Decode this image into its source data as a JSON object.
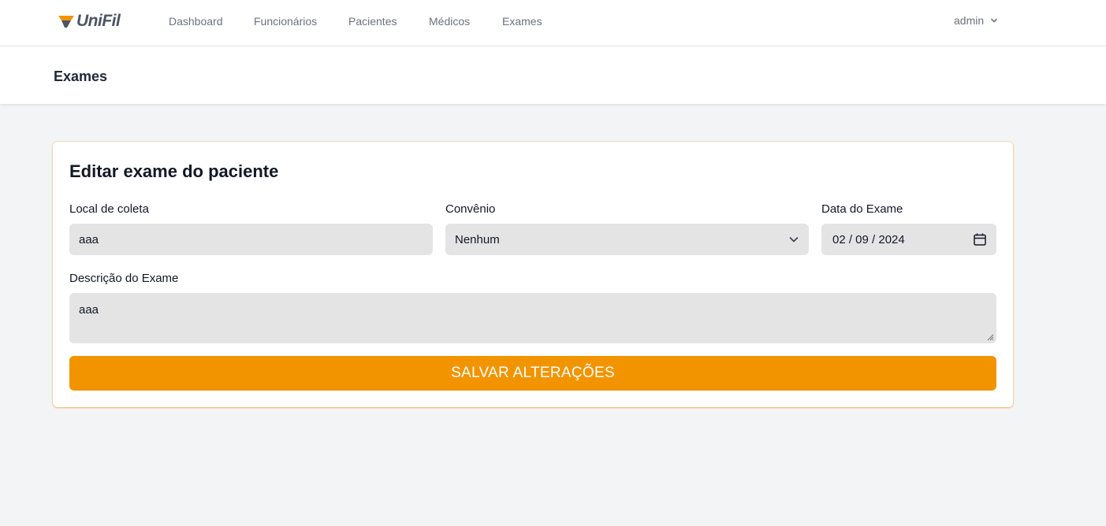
{
  "brand": {
    "name": "UniFil",
    "colors": {
      "accent": "#f29400",
      "logo_text": "#4b5563"
    }
  },
  "nav": {
    "items": [
      {
        "label": "Dashboard"
      },
      {
        "label": "Funcionários"
      },
      {
        "label": "Pacientes"
      },
      {
        "label": "Médicos"
      },
      {
        "label": "Exames"
      }
    ],
    "user": {
      "label": "admin",
      "icon": "chevron-down-icon"
    }
  },
  "header": {
    "title": "Exames"
  },
  "form": {
    "title": "Editar exame do paciente",
    "local_coleta": {
      "label": "Local de coleta",
      "value": "aaa"
    },
    "convenio": {
      "label": "Convênio",
      "value": "Nenhum",
      "icon": "chevron-down-icon"
    },
    "data_exame": {
      "label": "Data do Exame",
      "value": "02 / 09 / 2024",
      "icon": "calendar-icon"
    },
    "descricao": {
      "label": "Descrição do Exame",
      "value": "aaa"
    },
    "submit_label": "SALVAR ALTERAÇÕES"
  }
}
